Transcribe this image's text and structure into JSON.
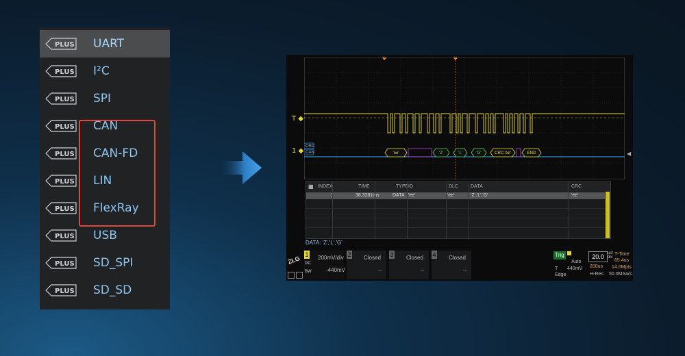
{
  "protocol_menu": {
    "badge": "PLUS",
    "items": [
      {
        "label": "UART",
        "selected": true
      },
      {
        "label": "I²C"
      },
      {
        "label": "SPI"
      },
      {
        "label": "CAN"
      },
      {
        "label": "CAN-FD"
      },
      {
        "label": "LIN"
      },
      {
        "label": "FlexRay"
      },
      {
        "label": "USB"
      },
      {
        "label": "SD_SPI"
      },
      {
        "label": "SD_SD"
      }
    ]
  },
  "scope": {
    "trigger_marker": "T",
    "ch1_marker": "1",
    "bus_tags": [
      "CRC",
      "CAN"
    ],
    "decode_segments": [
      "'ee'",
      "'Z'",
      "'L'",
      "'G'",
      "CRC:'ee'",
      "END"
    ],
    "decode_table": {
      "columns": [
        "INDEX",
        "TIME",
        "TYPE",
        "ID",
        "DLC",
        "DATA",
        "CRC"
      ],
      "rows": [
        [
          "1",
          "38.3281ms",
          "DATA",
          "'ee'",
          "'ee'",
          "'Z','L','G'",
          "'ee'"
        ]
      ]
    },
    "decode_summary": "DATA: 'Z','L','G'",
    "channels": [
      {
        "num": "1",
        "top": "200mV/div",
        "bottom": "-440mV",
        "color": "#e6d83a"
      },
      {
        "num": "2",
        "top": "Closed",
        "bottom": "--",
        "color": "#888"
      },
      {
        "num": "3",
        "top": "Closed",
        "bottom": "--",
        "color": "#888"
      },
      {
        "num": "4",
        "top": "Closed",
        "bottom": "--",
        "color": "#888"
      }
    ],
    "logo": "ZLG",
    "ch1_coupling": "DC",
    "ch1_bw": "BW",
    "trigger": {
      "label": "Trig",
      "mode": "Auto",
      "type": "T",
      "level": "440mV",
      "slope": "Edge"
    },
    "timebase": {
      "scale": "20.0",
      "unit_top": "us/",
      "unit_bottom": "div",
      "offset": "200us",
      "hres_label": "H-Res",
      "t_time_label": "T-Time",
      "t_time_value": "65.4us",
      "memory": "14.0Mpts",
      "sample_rate": "50.0MSa/s"
    }
  },
  "colors": {
    "menu_text": "#8ec6f2",
    "highlight_box": "#e04a3e",
    "ch1": "#e6d83a",
    "ch2": "#3fa8f5",
    "arrow": "#2e7fc6"
  }
}
